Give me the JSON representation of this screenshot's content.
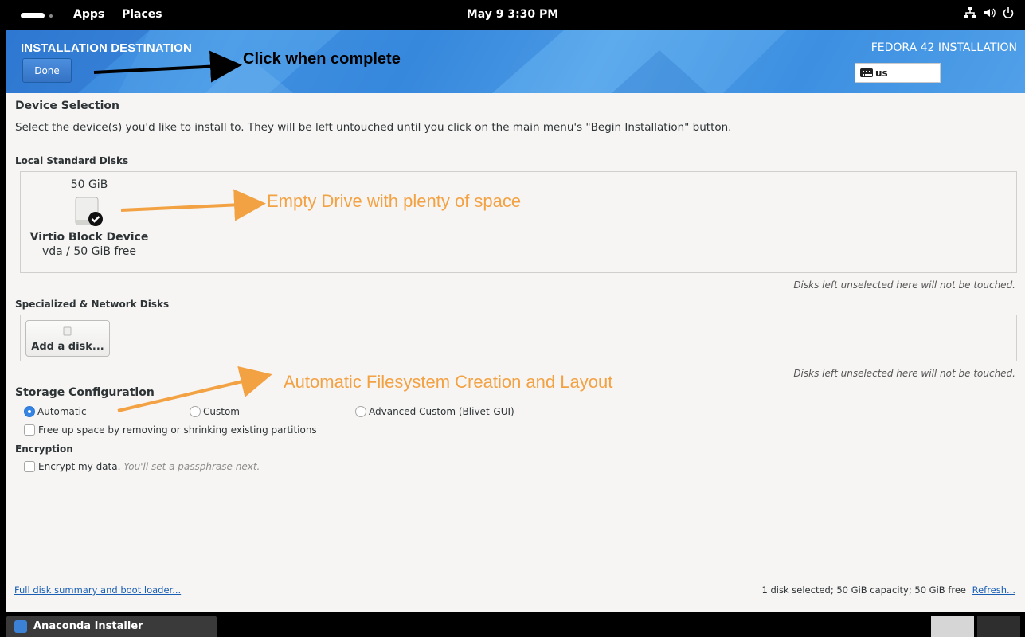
{
  "topbar": {
    "apps_label": "Apps",
    "places_label": "Places",
    "clock": "May 9   3:30 PM"
  },
  "header": {
    "spoke_title": "INSTALLATION DESTINATION",
    "done_label": "Done",
    "product_title": "FEDORA 42 INSTALLATION",
    "keyboard_layout": "us"
  },
  "device_selection": {
    "heading": "Device Selection",
    "description": "Select the device(s) you'd like to install to.  They will be left untouched until you click on the main menu's \"Begin Installation\" button.",
    "local_heading": "Local Standard Disks",
    "disk": {
      "size": "50 GiB",
      "name": "Virtio Block Device",
      "detail": "vda  /  50 GiB free",
      "selected": true
    },
    "local_note": "Disks left unselected here will not be touched.",
    "specialized_heading": "Specialized & Network Disks",
    "add_disk_label": "Add a disk...",
    "specialized_note": "Disks left unselected here will not be touched."
  },
  "storage": {
    "heading": "Storage Configuration",
    "options": [
      "Automatic",
      "Custom",
      "Advanced Custom (Blivet-GUI)"
    ],
    "selected": "Automatic",
    "free_space_label": "Free up space by removing or shrinking existing partitions",
    "encryption_heading": "Encryption",
    "encrypt_label": "Encrypt my data.",
    "encrypt_hint": "You'll set a passphrase next."
  },
  "footer": {
    "summary_link": "Full disk summary and boot loader...",
    "status": "1 disk selected; 50 GiB capacity; 50 GiB free",
    "refresh_link": "Refresh..."
  },
  "annotations": {
    "done": "Click when complete",
    "disk": "Empty Drive with plenty of space",
    "storage": "Automatic Filesystem Creation and Layout"
  },
  "taskbar": {
    "app_label": "Anaconda Installer"
  },
  "colors": {
    "accent": "#3584e4",
    "annotation_orange": "#f3a243",
    "link": "#1a5fb4"
  },
  "icons": [
    "network-wired-icon",
    "volume-icon",
    "power-icon",
    "keyboard-icon",
    "hard-disk-icon",
    "checkmark-icon",
    "anaconda-icon"
  ]
}
